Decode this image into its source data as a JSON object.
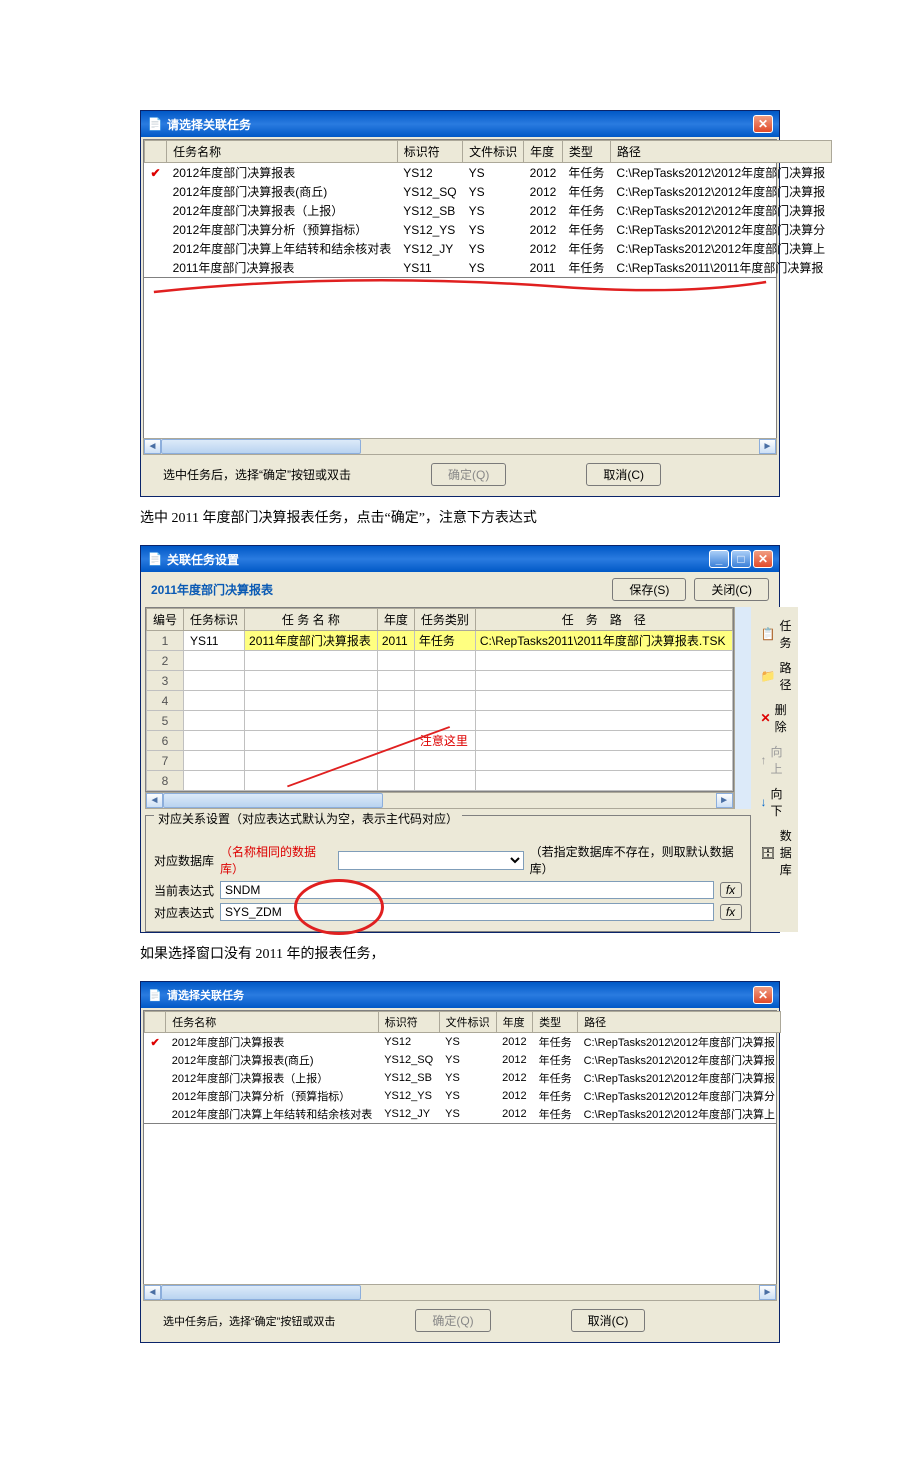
{
  "dialog1": {
    "title": "请选择关联任务",
    "columns": [
      "任务名称",
      "标识符",
      "文件标识",
      "年度",
      "类型",
      "路径"
    ],
    "rows": [
      {
        "checked": true,
        "name": "2012年度部门决算报表",
        "id": "YS12",
        "file": "YS",
        "year": "2012",
        "type": "年任务",
        "path": "C:\\RepTasks2012\\2012年度部门决算报"
      },
      {
        "checked": false,
        "name": "2012年度部门决算报表(商丘)",
        "id": "YS12_SQ",
        "file": "YS",
        "year": "2012",
        "type": "年任务",
        "path": "C:\\RepTasks2012\\2012年度部门决算报"
      },
      {
        "checked": false,
        "name": "2012年度部门决算报表（上报）",
        "id": "YS12_SB",
        "file": "YS",
        "year": "2012",
        "type": "年任务",
        "path": "C:\\RepTasks2012\\2012年度部门决算报"
      },
      {
        "checked": false,
        "name": "2012年度部门决算分析（预算指标）",
        "id": "YS12_YS",
        "file": "YS",
        "year": "2012",
        "type": "年任务",
        "path": "C:\\RepTasks2012\\2012年度部门决算分"
      },
      {
        "checked": false,
        "name": "2012年度部门决算上年结转和结余核对表",
        "id": "YS12_JY",
        "file": "YS",
        "year": "2012",
        "type": "年任务",
        "path": "C:\\RepTasks2012\\2012年度部门决算上"
      },
      {
        "checked": false,
        "name": "2011年度部门决算报表",
        "id": "YS11",
        "file": "YS",
        "year": "2011",
        "type": "年任务",
        "path": "C:\\RepTasks2011\\2011年度部门决算报"
      }
    ],
    "hint": "选中任务后，选择“确定”按钮或双击",
    "ok": "确定(Q)",
    "cancel": "取消(C)"
  },
  "doc_text_1": "选中 2011 年度部门决算报表任务，点击“确定”，注意下方表达式",
  "dialog2": {
    "win_title": "关联任务设置",
    "subtitle": "2011年度部门决算报表",
    "save": "保存(S)",
    "close": "关闭(C)",
    "grid_headers": [
      "编号",
      "任务标识",
      "任 务 名 称",
      "年度",
      "任务类别",
      "任　务　路　径"
    ],
    "grid_row": {
      "num": "1",
      "task_id": "YS11",
      "task_name": "2011年度部门决算报表",
      "year": "2011",
      "task_type": "年任务",
      "task_path": "C:\\RepTasks2011\\2011年度部门决算报表.TSK"
    },
    "note": "注意这里",
    "side": {
      "task": "任务",
      "path": "路径",
      "del": "删除",
      "up": "向上",
      "down": "向下",
      "db": "数据库"
    },
    "rel_section_title": "对应关系设置（对应表达式默认为空，表示主代码对应）",
    "db_label": "对应数据库",
    "db_hint": "（名称相同的数据库）",
    "db_hint2": "（若指定数据库不存在，则取默认数据库）",
    "cur_expr_label": "当前表达式",
    "cur_expr_value": "SNDM",
    "match_expr_label": "对应表达式",
    "match_expr_value": "SYS_ZDM"
  },
  "doc_text_2": "如果选择窗口没有 2011 年的报表任务，",
  "dialog3": {
    "title": "请选择关联任务",
    "columns": [
      "任务名称",
      "标识符",
      "文件标识",
      "年度",
      "类型",
      "路径"
    ],
    "rows": [
      {
        "checked": true,
        "name": "2012年度部门决算报表",
        "id": "YS12",
        "file": "YS",
        "year": "2012",
        "type": "年任务",
        "path": "C:\\RepTasks2012\\2012年度部门决算报"
      },
      {
        "checked": false,
        "name": "2012年度部门决算报表(商丘)",
        "id": "YS12_SQ",
        "file": "YS",
        "year": "2012",
        "type": "年任务",
        "path": "C:\\RepTasks2012\\2012年度部门决算报"
      },
      {
        "checked": false,
        "name": "2012年度部门决算报表（上报）",
        "id": "YS12_SB",
        "file": "YS",
        "year": "2012",
        "type": "年任务",
        "path": "C:\\RepTasks2012\\2012年度部门决算报"
      },
      {
        "checked": false,
        "name": "2012年度部门决算分析（预算指标）",
        "id": "YS12_YS",
        "file": "YS",
        "year": "2012",
        "type": "年任务",
        "path": "C:\\RepTasks2012\\2012年度部门决算分"
      },
      {
        "checked": false,
        "name": "2012年度部门决算上年结转和结余核对表",
        "id": "YS12_JY",
        "file": "YS",
        "year": "2012",
        "type": "年任务",
        "path": "C:\\RepTasks2012\\2012年度部门决算上"
      }
    ],
    "hint": "选中任务后，选择“确定”按钮或双击",
    "ok": "确定(Q)",
    "cancel": "取消(C)"
  }
}
